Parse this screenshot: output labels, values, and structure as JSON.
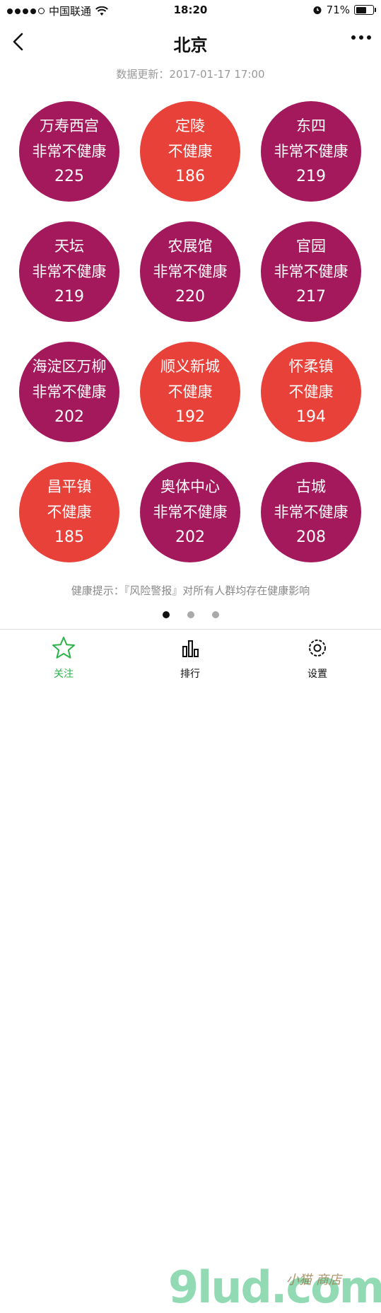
{
  "status_bar": {
    "carrier": "中国联通",
    "time": "18:20",
    "battery": "71%",
    "battery_level": 0.71
  },
  "nav": {
    "title": "北京",
    "back_icon": "chevron-left-icon",
    "more_icon": "more-dots-icon"
  },
  "update_text": "数据更新：2017-01-17 17:00",
  "colors": {
    "very_unhealthy": "#a3195b",
    "unhealthy": "#e8413a"
  },
  "stations": [
    {
      "name": "万寿西宫",
      "level": "非常不健康",
      "aqi": "225",
      "color": "#a3195b"
    },
    {
      "name": "定陵",
      "level": "不健康",
      "aqi": "186",
      "color": "#e8413a"
    },
    {
      "name": "东四",
      "level": "非常不健康",
      "aqi": "219",
      "color": "#a3195b"
    },
    {
      "name": "天坛",
      "level": "非常不健康",
      "aqi": "219",
      "color": "#a3195b"
    },
    {
      "name": "农展馆",
      "level": "非常不健康",
      "aqi": "220",
      "color": "#a3195b"
    },
    {
      "name": "官园",
      "level": "非常不健康",
      "aqi": "217",
      "color": "#a3195b"
    },
    {
      "name": "海淀区万柳",
      "level": "非常不健康",
      "aqi": "202",
      "color": "#a3195b"
    },
    {
      "name": "顺义新城",
      "level": "不健康",
      "aqi": "192",
      "color": "#e8413a"
    },
    {
      "name": "怀柔镇",
      "level": "不健康",
      "aqi": "194",
      "color": "#e8413a"
    },
    {
      "name": "昌平镇",
      "level": "不健康",
      "aqi": "185",
      "color": "#e8413a"
    },
    {
      "name": "奥体中心",
      "level": "非常不健康",
      "aqi": "202",
      "color": "#a3195b"
    },
    {
      "name": "古城",
      "level": "非常不健康",
      "aqi": "208",
      "color": "#a3195b"
    }
  ],
  "health_tip": "健康提示：『风险警报』对所有人群均存在健康影响",
  "pager": {
    "pages": 3,
    "active": 1
  },
  "tabs": [
    {
      "label": "关注",
      "icon": "star-icon",
      "active": true,
      "color": "#2bb34a"
    },
    {
      "label": "排行",
      "icon": "ranking-icon",
      "active": false,
      "color": "#111111"
    },
    {
      "label": "设置",
      "icon": "settings-icon",
      "active": false,
      "color": "#111111"
    }
  ],
  "watermark": {
    "text": "9lud.com",
    "sub": "小猫 商店"
  }
}
